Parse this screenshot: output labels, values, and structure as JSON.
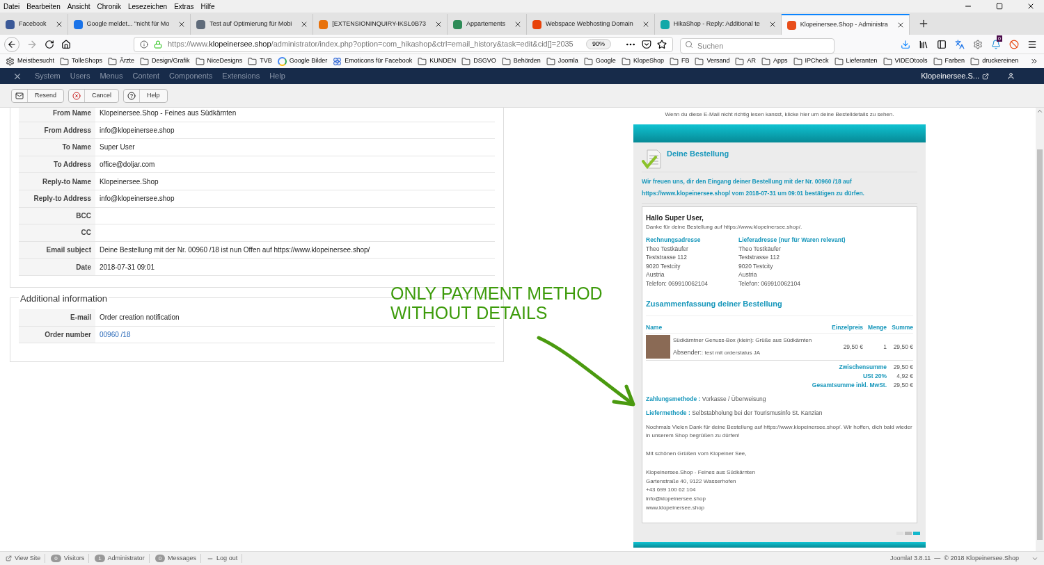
{
  "menu_bar": [
    "Datei",
    "Bearbeiten",
    "Ansicht",
    "Chronik",
    "Lesezeichen",
    "Extras",
    "Hilfe"
  ],
  "tabs": [
    {
      "label": "Facebook",
      "selected": false,
      "color": "#3b5998"
    },
    {
      "label": "Google meldet... \"nicht für Mo",
      "selected": false,
      "color": "#1a73e8"
    },
    {
      "label": "Test auf Optimierung für Mobi",
      "selected": false,
      "color": "#5f6b7a"
    },
    {
      "label": "[EXTENSIONINQUIRY-IKSL0B73",
      "selected": false,
      "color": "#e8710a"
    },
    {
      "label": "Appartements",
      "selected": false,
      "color": "#2e8b57"
    },
    {
      "label": "Webspace Webhosting Domain",
      "selected": false,
      "color": "#e8430a"
    },
    {
      "label": "HikaShop - Reply: Additional te",
      "selected": false,
      "color": "#13a8a8"
    },
    {
      "label": "Klopeinersee.Shop - Administra",
      "selected": true,
      "color": "#e84e1b"
    }
  ],
  "address_bar": {
    "url_prefix": "https://www.",
    "url_domain": "klopeinersee.shop",
    "url_path": "/administrator/index.php?option=com_hikashop&ctrl=email_history&task=edit&cid[]=2035",
    "zoom": "90%"
  },
  "search": {
    "placeholder": "Suchen"
  },
  "notification_count": "0",
  "bookmarks": [
    {
      "label": "Meistbesucht",
      "kind": "gear"
    },
    {
      "label": "TolleShops",
      "kind": "folder"
    },
    {
      "label": "Ärzte",
      "kind": "folder"
    },
    {
      "label": "Design/Grafik",
      "kind": "folder"
    },
    {
      "label": "NiceDesigns",
      "kind": "folder"
    },
    {
      "label": "TVB",
      "kind": "folder"
    },
    {
      "label": "Google Bilder",
      "kind": "google"
    },
    {
      "label": "Emoticons für Facebook",
      "kind": "flower"
    },
    {
      "label": "KUNDEN",
      "kind": "folder"
    },
    {
      "label": "DSGVO",
      "kind": "folder"
    },
    {
      "label": "Behörden",
      "kind": "folder"
    },
    {
      "label": "Joomla",
      "kind": "folder"
    },
    {
      "label": "Google",
      "kind": "folder"
    },
    {
      "label": "KlopeShop",
      "kind": "folder"
    },
    {
      "label": "FB",
      "kind": "folder"
    },
    {
      "label": "Versand",
      "kind": "folder"
    },
    {
      "label": "AR",
      "kind": "folder"
    },
    {
      "label": "Apps",
      "kind": "folder"
    },
    {
      "label": "IPCheck",
      "kind": "folder"
    },
    {
      "label": "Lieferanten",
      "kind": "folder"
    },
    {
      "label": "VIDEOtools",
      "kind": "folder"
    },
    {
      "label": "Farben",
      "kind": "folder"
    },
    {
      "label": "druckereinen",
      "kind": "folder"
    }
  ],
  "admin_menu": {
    "items": [
      "System",
      "Users",
      "Menus",
      "Content",
      "Components",
      "Extensions",
      "Help"
    ],
    "site_link": "Klopeinersee.S..."
  },
  "toolbar": [
    {
      "label": "Resend",
      "kind": "send"
    },
    {
      "label": "Cancel",
      "kind": "cancel"
    },
    {
      "label": "Help",
      "kind": "help"
    }
  ],
  "email_fields": [
    {
      "label": "From Name",
      "value": "Klopeinersee.Shop - Feines aus Südkärnten"
    },
    {
      "label": "From Address",
      "value": "info@klopeinersee.shop"
    },
    {
      "label": "To Name",
      "value": "Super User"
    },
    {
      "label": "To Address",
      "value": "office@doljar.com"
    },
    {
      "label": "Reply-to Name",
      "value": "Klopeinersee.Shop"
    },
    {
      "label": "Reply-to Address",
      "value": "info@klopeinersee.shop"
    },
    {
      "label": "BCC"
    },
    {
      "label": "CC"
    },
    {
      "label": "Email subject",
      "value": "Deine Bestellung mit der Nr. 00960 /18 ist nun Offen auf https://www.klopeinersee.shop/"
    },
    {
      "label": "Date",
      "value": "2018-07-31 09:01"
    }
  ],
  "additional_information": {
    "title": "Additional information",
    "rows": [
      {
        "label": "E-mail",
        "value": "Order creation notification",
        "kind": "text"
      },
      {
        "label": "Order number",
        "value": "00960 /18",
        "kind": "link"
      }
    ]
  },
  "annotation": [
    "ONLY PAYMENT METHOD",
    "WITHOUT DETAILS"
  ],
  "email_preview": {
    "notice": "Wenn du diese E-Mail nicht richtig lesen kansst, klicke hier um deine Bestelldetails zu sehen.",
    "heading": "Deine Bestellung",
    "intro": "Wir freuen uns, dir den Eingang deiner Bestellung mit der Nr. 00960 /18 auf https://www.klopeinersee.shop/ vom 2018-07-31 um 09:01 bestätigen zu dürfen.",
    "greeting": "Hallo Super User,",
    "thanks": "Danke für deine Bestellung auf https://www.klopeinersee.shop/.",
    "addresses": [
      {
        "title": "Rechnungsadresse",
        "lines": [
          "Theo Testkäufer",
          "Teststrasse 112",
          "9020 Testcity",
          "Austria",
          "Telefon: 069910062104"
        ]
      },
      {
        "title": "Lieferadresse (nur für Waren relevant)",
        "lines": [
          "Theo Testkäufer",
          "Teststrasse 112",
          "9020 Testcity",
          "Austria",
          "Telefon: 069910062104"
        ]
      }
    ],
    "summary_title": "Zusammenfassung deiner Bestellung",
    "columns": [
      "Name",
      "Einzelpreis",
      "Menge",
      "Summe"
    ],
    "items": [
      {
        "name": "Südkärntner Genuss-Box (klein): Grüße aus Südkärnten",
        "note_label": "Absender:",
        "note": ": test mit orderstatus JA",
        "price": "29,50 €",
        "quantity": "1",
        "total": "29,50 €"
      }
    ],
    "totals": [
      {
        "label": "Zwischensumme",
        "value": "29,50 €"
      },
      {
        "label": "USt 20%",
        "value": "4,92 €"
      },
      {
        "label": "Gesamtsumme inkl. MwSt.",
        "value": "29,50 €"
      }
    ],
    "methods": [
      {
        "label": "Zahlungsmethode :",
        "value": "Vorkasse / Überweisung"
      },
      {
        "label": "Liefermethode :",
        "value": "Selbstabholung bei der Tourismusinfo St. Kanzian"
      }
    ],
    "closing": "Nochmals Vielen Dank für deine Bestellung auf https://www.klopeinersee.shop/. Wir hoffen, dich bald wieder in unserem Shop begrüßen zu dürfen!",
    "regards": "Mit schönen Grüßen vom Klopeiner See,",
    "signature": [
      "Klopeinersee.Shop - Feines aus Südkärnten",
      "Gartenstraße 40, 9122 Wasserhofen",
      "+43 699 100 62 104",
      "info@klopeinersee.shop",
      "www.klopeinersee.shop"
    ]
  },
  "status_bar": {
    "left": [
      {
        "label": "View Site",
        "kind": "link"
      },
      {
        "label": "Visitors",
        "count": "0",
        "kind": "count"
      },
      {
        "label": "Administrator",
        "count": "1",
        "kind": "count"
      },
      {
        "label": "Messages",
        "count": "0",
        "kind": "count"
      },
      {
        "label": "Log out",
        "kind": "logout"
      }
    ],
    "right": "Joomla! 3.8.11  —  © 2018 Klopeinersee.Shop"
  }
}
